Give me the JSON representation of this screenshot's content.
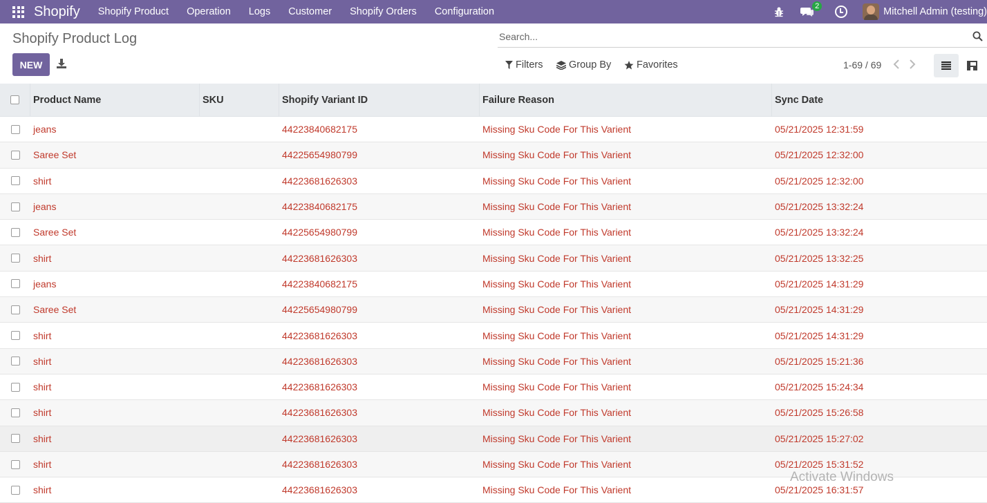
{
  "navbar": {
    "brand": "Shopify",
    "menu": [
      "Shopify Product",
      "Operation",
      "Logs",
      "Customer",
      "Shopify Orders",
      "Configuration"
    ],
    "chat_count": "2",
    "user_name": "Mitchell Admin (testing)"
  },
  "control": {
    "page_title": "Shopify Product Log",
    "new_label": "NEW",
    "search_placeholder": "Search...",
    "filters_label": "Filters",
    "groupby_label": "Group By",
    "favorites_label": "Favorites",
    "pager": "1-69 / 69"
  },
  "table": {
    "headers": [
      "Product Name",
      "SKU",
      "Shopify Variant ID",
      "Failure Reason",
      "Sync Date"
    ],
    "rows": [
      {
        "name": "jeans",
        "sku": "",
        "variant_id": "44223840682175",
        "failure": "Missing Sku Code For This Varient",
        "sync_date": "05/21/2025 12:31:59"
      },
      {
        "name": "Saree Set",
        "sku": "",
        "variant_id": "44225654980799",
        "failure": "Missing Sku Code For This Varient",
        "sync_date": "05/21/2025 12:32:00"
      },
      {
        "name": "shirt",
        "sku": "",
        "variant_id": "44223681626303",
        "failure": "Missing Sku Code For This Varient",
        "sync_date": "05/21/2025 12:32:00"
      },
      {
        "name": "jeans",
        "sku": "",
        "variant_id": "44223840682175",
        "failure": "Missing Sku Code For This Varient",
        "sync_date": "05/21/2025 13:32:24"
      },
      {
        "name": "Saree Set",
        "sku": "",
        "variant_id": "44225654980799",
        "failure": "Missing Sku Code For This Varient",
        "sync_date": "05/21/2025 13:32:24"
      },
      {
        "name": "shirt",
        "sku": "",
        "variant_id": "44223681626303",
        "failure": "Missing Sku Code For This Varient",
        "sync_date": "05/21/2025 13:32:25"
      },
      {
        "name": "jeans",
        "sku": "",
        "variant_id": "44223840682175",
        "failure": "Missing Sku Code For This Varient",
        "sync_date": "05/21/2025 14:31:29"
      },
      {
        "name": "Saree Set",
        "sku": "",
        "variant_id": "44225654980799",
        "failure": "Missing Sku Code For This Varient",
        "sync_date": "05/21/2025 14:31:29"
      },
      {
        "name": "shirt",
        "sku": "",
        "variant_id": "44223681626303",
        "failure": "Missing Sku Code For This Varient",
        "sync_date": "05/21/2025 14:31:29"
      },
      {
        "name": "shirt",
        "sku": "",
        "variant_id": "44223681626303",
        "failure": "Missing Sku Code For This Varient",
        "sync_date": "05/21/2025 15:21:36"
      },
      {
        "name": "shirt",
        "sku": "",
        "variant_id": "44223681626303",
        "failure": "Missing Sku Code For This Varient",
        "sync_date": "05/21/2025 15:24:34"
      },
      {
        "name": "shirt",
        "sku": "",
        "variant_id": "44223681626303",
        "failure": "Missing Sku Code For This Varient",
        "sync_date": "05/21/2025 15:26:58"
      },
      {
        "name": "shirt",
        "sku": "",
        "variant_id": "44223681626303",
        "failure": "Missing Sku Code For This Varient",
        "sync_date": "05/21/2025 15:27:02"
      },
      {
        "name": "shirt",
        "sku": "",
        "variant_id": "44223681626303",
        "failure": "Missing Sku Code For This Varient",
        "sync_date": "05/21/2025 15:31:52"
      },
      {
        "name": "shirt",
        "sku": "",
        "variant_id": "44223681626303",
        "failure": "Missing Sku Code For This Varient",
        "sync_date": "05/21/2025 16:31:57"
      }
    ]
  },
  "watermark": "Activate Windows",
  "colors": {
    "navbar": "#71639e",
    "accent": "#71639e",
    "row_text": "#c0392b",
    "chat_badge": "#28a745"
  }
}
